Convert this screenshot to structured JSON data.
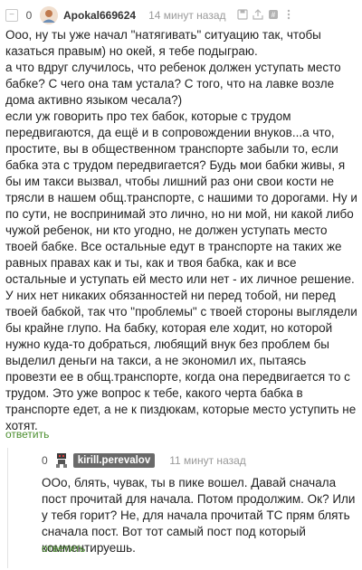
{
  "comment1": {
    "rating": "0",
    "author": "Apokal669624",
    "time": "14 минут назад",
    "paragraphs": [
      "Ооо, ну ты уже начал \"натягивать\" ситуацию так, чтобы казаться правым) но окей, я тебе подыграю.",
      "а что вдруг случилось, что ребенок должен уступать место бабке? С чего она там устала? С того, что на лавке возле дома активно языком чесала?)",
      "если уж говорить про тех бабок, которые с трудом передвигаются, да ещё и в сопровождении внуков...а что, простите, вы в общественном транспорте забыли то, если бабка эта с трудом передвигается? Будь мои бабки живы, я бы им такси вызвал, чтобы лишний раз они свои кости не трясли в нашем общ.транспорте, с нашими то дорогами. Ну и по сути, не воспринимай это лично, но ни мой, ни какой либо чужой ребенок, ни кто угодно, не должен уступать место твоей бабке. Все остальные едут в транспорте на таких же равных правах как и ты, как и твоя бабка, как и все остальные и уступать ей место или нет - их личное решение. У них нет никаких обязанностей ни перед тобой, ни перед твоей бабкой, так что \"проблемы\" с твоей стороны выглядели бы крайне глупо. На бабку, которая еле ходит, но которой нужно куда-то добраться, любящий внук без проблем бы выделил деньги на такси, а не экономил их, пытаясь провезти ее в общ.транспорте, когда она передвигается то с трудом. Это уже вопрос к тебе, какого черта бабка в транспорте едет, а не к пиздюкам, которые место уступить не хотят."
    ],
    "reply_label": "ответить"
  },
  "comment2": {
    "rating": "0",
    "author": "kirill.perevalov",
    "time": "11 минут назад",
    "paragraphs": [
      "ООо, блять, чувак, ты в пике вошел. Давай сначала пост прочитай для начала. Потом продолжим. Ок? Или у тебя горит? Не, для начала прочитай ТС прям блять сначала пост. Вот тот самый пост под который комментируешь."
    ],
    "reply_label": "ответить"
  },
  "accent_color": "#4b8e2e",
  "author_badge_color": "#6a6a6a",
  "icons": [
    "collapse-icon",
    "save-icon",
    "share-icon",
    "link-icon",
    "more-icon"
  ]
}
